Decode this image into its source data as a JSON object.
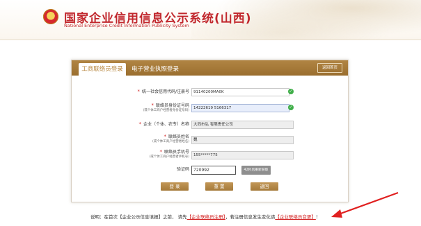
{
  "header": {
    "title": "国家企业信用信息公示系统(山西)",
    "subtitle": "National Enterprise Credit Information Publicity System"
  },
  "tabs": {
    "active": "工商联络员登录",
    "other": "电子营业执照登录",
    "home_button": "返回首页"
  },
  "form": {
    "credit_code": {
      "label": "统一社会信用代码/注册号",
      "value": "91140200MA0K"
    },
    "id_number": {
      "label": "联络员身份证号码",
      "sub": "(或个体工商户经营者身份证号码)",
      "value": "14222619    5166317"
    },
    "company_name": {
      "label": "企业（个体、农专）名称",
      "value": "大同市弘    有限责任公司"
    },
    "contact_name": {
      "label": "联络员姓名",
      "sub": "(或个体工商户经营者姓名)",
      "value": "魏"
    },
    "contact_phone": {
      "label": "联络员手机号",
      "sub": "(或个体工商户经营者手机号)",
      "value": "155*****775"
    },
    "captcha": {
      "label": "验证码",
      "value": "720992",
      "button": "42秒后重新获取"
    }
  },
  "buttons": {
    "login": "登 录",
    "reset": "重 置",
    "back": "返回"
  },
  "footer": {
    "prefix": "说明：在首次【企业公示信息填报】之前， 请先",
    "link1": "【企业联络员注册】",
    "middle": "，若注册信息发生变化请",
    "link2": "【企业联络员变更】",
    "suffix": "！"
  },
  "colors": {
    "brand_red": "#c1272d",
    "tab_gold": "#b18543",
    "valid_green": "#3fae49"
  }
}
